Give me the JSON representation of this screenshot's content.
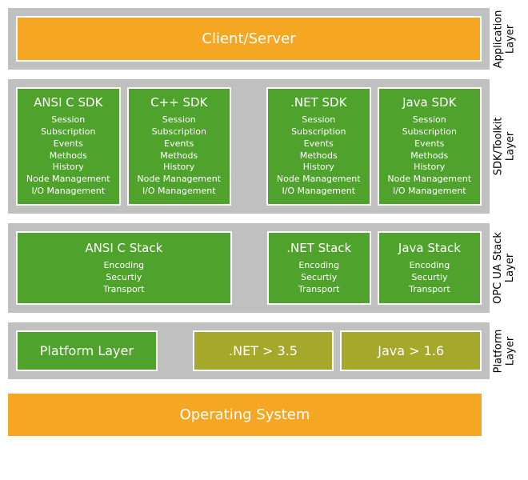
{
  "layers": {
    "application": {
      "side_label": "Application\nLayer",
      "block": "Client/Server"
    },
    "sdk": {
      "side_label": "SDK/Toolkit\nLayer",
      "boxes": [
        {
          "title": "ANSI C SDK"
        },
        {
          "title": "C++ SDK"
        },
        {
          "title": ".NET SDK"
        },
        {
          "title": "Java SDK"
        }
      ],
      "features": [
        "Session",
        "Subscription",
        "Events",
        "Methods",
        "History",
        "Node Management",
        "I/O Management"
      ]
    },
    "stack": {
      "side_label": "OPC UA Stack\nLayer",
      "boxes": [
        {
          "title": "ANSI C Stack"
        },
        {
          "title": ".NET Stack"
        },
        {
          "title": "Java Stack"
        }
      ],
      "features": [
        "Encoding",
        "Securtiy",
        "Transport"
      ]
    },
    "platform": {
      "side_label": "Platform\nLayer",
      "boxes": [
        {
          "title": "Platform Layer",
          "color": "green"
        },
        {
          "title": ".NET > 3.5",
          "color": "olive"
        },
        {
          "title": "Java > 1.6",
          "color": "olive"
        }
      ]
    },
    "os": {
      "block": "Operating System"
    }
  },
  "colors": {
    "orange": "#f5a623",
    "green": "#4fa22c",
    "olive": "#a6a82c",
    "grey": "#c0c0c0"
  }
}
